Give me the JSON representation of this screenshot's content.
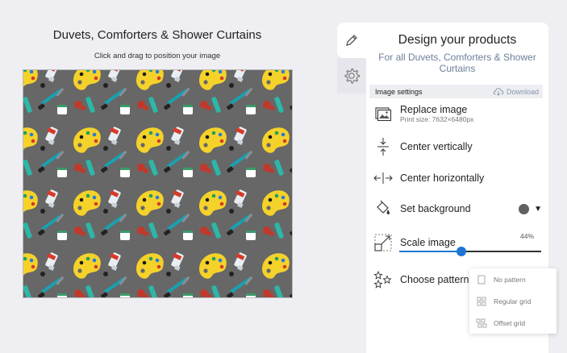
{
  "editor": {
    "product_title": "Duvets, Comforters & Shower Curtains",
    "drag_hint": "Click and drag to position your image"
  },
  "side_tabs": [
    {
      "name": "design",
      "icon": "pencil-icon",
      "active": true
    },
    {
      "name": "settings",
      "icon": "gear-icon",
      "active": false
    }
  ],
  "panel": {
    "title": "Design your products",
    "subtitle": "For all Duvets, Comforters & Shower Curtains",
    "settings_label": "Image settings",
    "download_label": "Download",
    "replace_label": "Replace image",
    "print_size": "Print size: 7632×6480px",
    "center_v_label": "Center vertically",
    "center_h_label": "Center horizontally",
    "background_label": "Set background",
    "background_color": "#616161",
    "scale_label": "Scale image",
    "scale_value": "44%",
    "scale_fraction": 0.44,
    "pattern_label": "Choose pattern"
  },
  "pattern_options": {
    "none": "No pattern",
    "regular": "Regular grid",
    "offset": "Offset grid"
  },
  "colors": {
    "accent": "#1f76d2",
    "canvas_bg": "#676767",
    "palette_yellow": "#f5d22a"
  }
}
